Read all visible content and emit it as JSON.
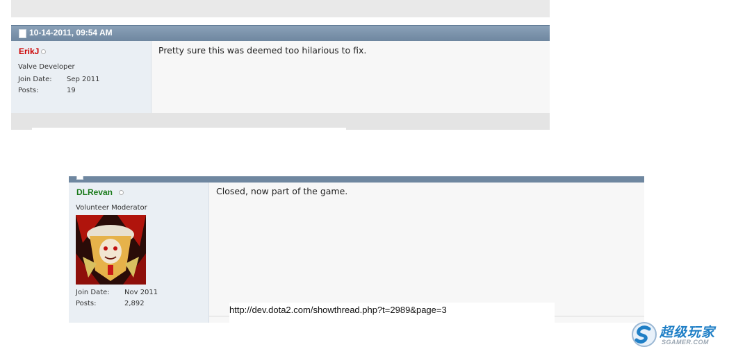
{
  "post1": {
    "date": "10-14-2011, 09:54 AM",
    "username": "ErikJ",
    "username_color": "#cc0000",
    "user_title": "Valve Developer",
    "join_date_label": "Join Date:",
    "join_date": "Sep 2011",
    "posts_label": "Posts:",
    "posts": "19",
    "message": "Pretty sure this was deemed too hilarious to fix."
  },
  "post2": {
    "username": "DLRevan",
    "username_color": "#1a7a1a",
    "user_title": "Volunteer Moderator",
    "join_date_label": "Join Date:",
    "join_date": "Nov 2011",
    "posts_label": "Posts:",
    "posts": "2,892",
    "message": "Closed, now part of the game."
  },
  "source_url": "http://dev.dota2.com/showthread.php?t=2989&page=3",
  "watermark": {
    "name": "超级玩家",
    "domain": "SGAMER.COM"
  },
  "icons": {
    "post_icon": "document-icon",
    "status": "offline-status-icon",
    "logo": "sgamer-logo-icon"
  },
  "colors": {
    "header_bar": "#7890a8",
    "userinfo_bg": "#eaeff4",
    "message_bg": "#f7f7f7"
  }
}
